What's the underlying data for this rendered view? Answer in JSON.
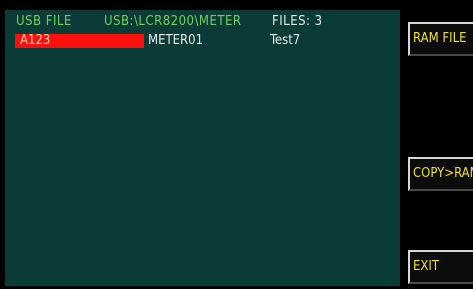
{
  "header": {
    "mode": "USB FILE",
    "path": "USB:\\LCR8200\\METER",
    "files": "FILES: 3"
  },
  "files": [
    {
      "name": "A123",
      "folder": "METER01",
      "comment": "Test7"
    }
  ],
  "softkeys": {
    "ram_file": "RAM FILE",
    "copy_ram": "COPY>RAM",
    "exit": "EXIT"
  },
  "colors": {
    "screen_bg": "#0b3b37",
    "header_text": "#6dd35b",
    "selection": "#ff1010",
    "softkey_text": "#f0df3a"
  }
}
